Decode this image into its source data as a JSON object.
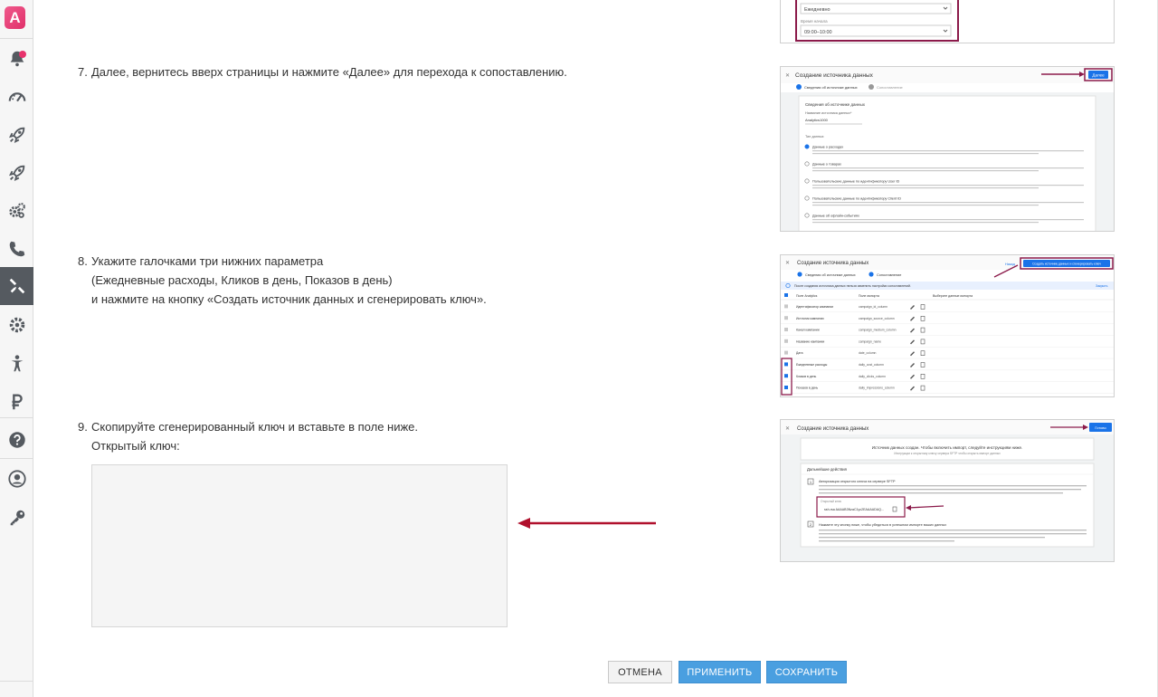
{
  "sidebar": {
    "logo_letter": "A",
    "items": [
      {
        "name": "notifications",
        "icon": "bell-icon"
      },
      {
        "name": "dashboard",
        "icon": "speedometer-icon"
      },
      {
        "name": "campaigns",
        "icon": "rocket-icon"
      },
      {
        "name": "campaigns-2",
        "icon": "rocket-icon"
      },
      {
        "name": "automation",
        "icon": "gears-icon"
      },
      {
        "name": "calls",
        "icon": "phone-icon"
      },
      {
        "name": "tools",
        "icon": "tools-icon"
      },
      {
        "name": "settings",
        "icon": "gear-icon"
      },
      {
        "name": "accessibility",
        "icon": "person-icon"
      },
      {
        "name": "billing",
        "icon": "ruble-icon"
      },
      {
        "name": "help",
        "icon": "question-icon"
      },
      {
        "name": "profile",
        "icon": "user-icon"
      },
      {
        "name": "access-keys",
        "icon": "key-icon"
      }
    ],
    "accent_color": "#e8336d",
    "active_bg": "#555a60"
  },
  "steps": {
    "step7": {
      "number": "7.",
      "text": "Далее, вернитесь вверх страницы и нажмите «Далее» для перехода к сопоставлению."
    },
    "step8": {
      "number": "8.",
      "line1": "Укажите галочками три нижних параметра",
      "line2": "(Ежедневные расходы, Кликов в день, Показов в день)",
      "line3": "и нажмите на кнопку «Создать источник данных и сгенерировать ключ»."
    },
    "step9": {
      "number": "9.",
      "line1": "Скопируйте сгенерированный ключ и вставьте в поле ниже.",
      "line2": "Открытый ключ:"
    }
  },
  "public_key": {
    "value": ""
  },
  "thumbs": {
    "top": {
      "label": "Время начала",
      "select1": "Ежедневно",
      "select2": "09:00–10:00"
    },
    "step7": {
      "title": "Создание источника данных",
      "next_button": "Далее",
      "tab1": "Сведения об источнике данных",
      "tab2": "Сопоставление",
      "section": "Сведения об источнике данных",
      "name_label": "Название источника данных*",
      "name_value": "Analytics1000",
      "type_label": "Тип данных",
      "options": [
        "Данные о расходах",
        "Данные о товарах",
        "Пользовательские данные по идентификатору User ID",
        "Пользовательские данные по идентификатору Client ID",
        "Данные об офлайн-событиях"
      ]
    },
    "step8": {
      "title": "Создание источника данных",
      "back_button": "Назад",
      "create_button": "Создать источник данных и сгенерировать ключ",
      "tab1": "Сведения об источнике данных",
      "tab2": "Сопоставление",
      "info": "После создания источника данных нельзя изменить настройки сопоставлений.",
      "info_link": "Закрыть",
      "col1": "Поле Analytics",
      "col2": "Поле импорта",
      "col3": "Выберите данные импорта",
      "rows": [
        {
          "field": "Идентификатор кампании",
          "import": "campaign_id_column",
          "checked": false
        },
        {
          "field": "Источник кампании",
          "import": "campaign_source_column",
          "checked": false
        },
        {
          "field": "Канал кампании",
          "import": "campaign_medium_column",
          "checked": false
        },
        {
          "field": "Название кампании",
          "import": "campaign_name",
          "checked": false
        },
        {
          "field": "Дата",
          "import": "date_column",
          "checked": false
        },
        {
          "field": "Ежедневные расходы",
          "import": "daily_cost_column",
          "checked": true
        },
        {
          "field": "Кликов в день",
          "import": "daily_clicks_column",
          "checked": true
        },
        {
          "field": "Показов в день",
          "import": "daily_impressions_column",
          "checked": true
        }
      ]
    },
    "step9": {
      "title": "Создание источника данных",
      "done_button": "Готово",
      "created_title": "Источник данных создан. Чтобы включить импорт, следуйте инструкциям ниже.",
      "created_sub": "Инструкции к открытому ключу сервера SFTP чтобы открыть импорт данных",
      "next_steps": "Дальнейшие действия",
      "step1_title": "Авторизация открытого ключа на сервере SFTP",
      "key_label": "Открытый ключ",
      "key_value": "ssh-rsa AAAAB3NzaC1yc2EAAAADAQ...",
      "step2_title": "Нажмите эту кнопку ниже, чтобы убедиться в успешном импорте ваших данных"
    }
  },
  "footer": {
    "cancel": "ОТМЕНА",
    "apply": "ПРИМЕНИТЬ",
    "save": "СОХРАНИТЬ"
  },
  "colors": {
    "primary_button": "#4a9fe0",
    "highlight": "#8b1a4a",
    "arrow": "#b0102c"
  }
}
